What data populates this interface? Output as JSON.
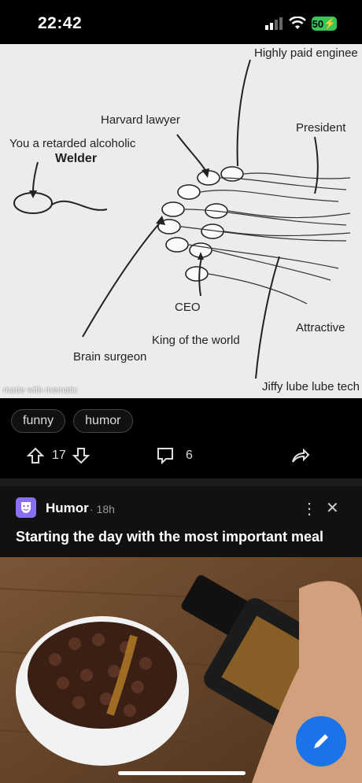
{
  "status": {
    "time": "22:42",
    "battery": "50"
  },
  "meme": {
    "labels": {
      "highly_paid": "Highly paid enginee",
      "harvard": "Harvard lawyer",
      "president": "President",
      "retarded": "You a retarded alcoholic",
      "welder": "Welder",
      "ceo": "CEO",
      "attractive": "Attractive",
      "king": "King of the world",
      "brain": "Brain surgeon",
      "jiffy": "Jiffy lube lube tech"
    },
    "watermark": "made with mematic"
  },
  "tags": [
    "funny",
    "humor"
  ],
  "actions": {
    "votes": "17",
    "comments": "6"
  },
  "post2": {
    "subreddit": "Humor",
    "age": "· 18h",
    "title": "Starting the day with the most important meal"
  },
  "icons": [
    "upvote-icon",
    "downvote-icon",
    "comment-icon",
    "share-icon",
    "more-icon",
    "close-icon",
    "pencil-icon"
  ]
}
